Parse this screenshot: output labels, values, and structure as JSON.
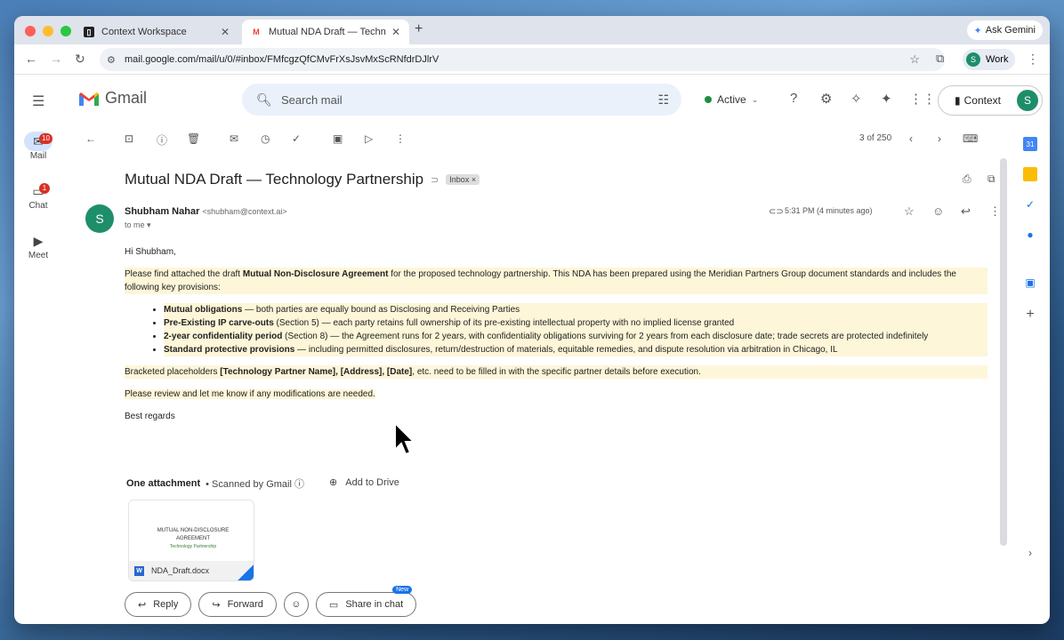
{
  "browser": {
    "tabs": [
      {
        "label": "Context Workspace",
        "icon": "context-icon"
      },
      {
        "label": "Mutual NDA Draft — Technolo",
        "icon": "gmail-icon"
      }
    ],
    "ask_gemini": "Ask Gemini",
    "url": "mail.google.com/mail/u/0/#inbox/FMfcgzQfCMvFrXsJsvMxScRNfdrDJlrV",
    "profile_label": "Work",
    "profile_initial": "S"
  },
  "gmail": {
    "logo_text": "Gmail",
    "search_placeholder": "Search mail",
    "status": "Active",
    "context_label": "Context",
    "avatar_initial": "S",
    "rail": [
      {
        "label": "Mail",
        "badge": "10"
      },
      {
        "label": "Chat",
        "badge": "1"
      },
      {
        "label": "Meet",
        "badge": ""
      }
    ],
    "pager": "3 of 250"
  },
  "email": {
    "subject": "Mutual NDA Draft — Technology Partnership",
    "label": "Inbox ×",
    "sender_initial": "S",
    "sender_name": "Shubham Nahar",
    "sender_email": "<shubham@context.ai>",
    "to": "to me ▾",
    "time": "5:31 PM (4 minutes ago)",
    "greeting": "Hi Shubham,",
    "intro_pre": "Please find attached the draft ",
    "intro_bold": "Mutual Non-Disclosure Agreement",
    "intro_post": " for the proposed technology partnership. This NDA has been prepared using the Meridian Partners Group document standards and includes the following key provisions:",
    "bullets": [
      {
        "bold": "Mutual obligations",
        "text": " — both parties are equally bound as Disclosing and Receiving Parties"
      },
      {
        "bold": "Pre-Existing IP carve-outs",
        "text": " (Section 5) — each party retains full ownership of its pre-existing intellectual property with no implied license granted"
      },
      {
        "bold": "2-year confidentiality period",
        "text": " (Section 8) — the Agreement runs for 2 years, with confidentiality obligations surviving for 2 years from each disclosure date; trade secrets are protected indefinitely"
      },
      {
        "bold": "Standard protective provisions",
        "text": " — including permitted disclosures, return/destruction of materials, equitable remedies, and dispute resolution via arbitration in Chicago, IL"
      }
    ],
    "placeholders_pre": "Bracketed placeholders ",
    "placeholders_bold": "[Technology Partner Name], [Address], [Date]",
    "placeholders_post": ", etc. need to be filled in with the specific partner details before execution.",
    "review": "Please review and let me know if any modifications are needed.",
    "signoff": "Best regards",
    "attachment_heading": "One attachment",
    "scanned": "• Scanned by Gmail ⓘ",
    "add_to_drive": "Add to Drive",
    "attachment_doc_title": "MUTUAL NON-DISCLOSURE AGREEMENT",
    "attachment_doc_sub": "Technology Partnership",
    "attachment_name": "NDA_Draft.docx",
    "reply": "Reply",
    "forward": "Forward",
    "share_in_chat": "Share in chat",
    "new_badge": "New"
  },
  "colors": {
    "highlight": "#fdf6d8",
    "avatar": "#1e8e6a",
    "badge": "#d93025",
    "accent": "#1a73e8"
  }
}
